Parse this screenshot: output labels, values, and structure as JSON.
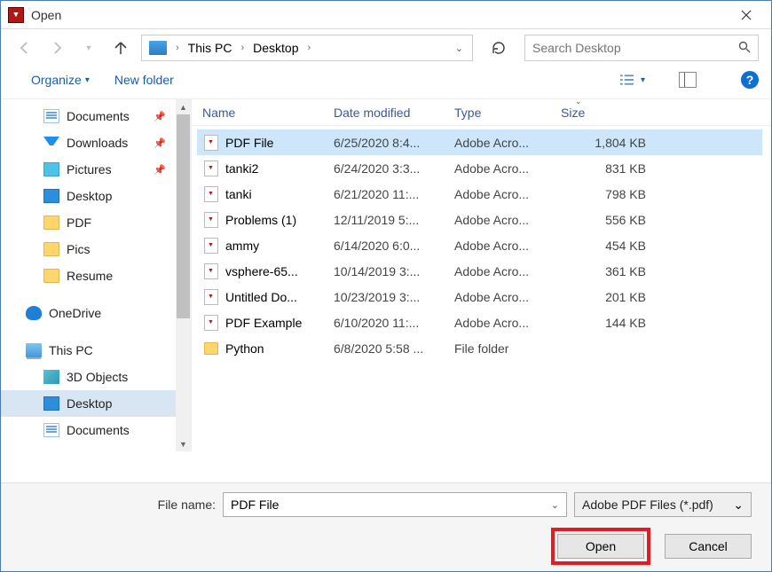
{
  "title": "Open",
  "breadcrumbs": {
    "item0": "This PC",
    "item1": "Desktop"
  },
  "search": {
    "placeholder": "Search Desktop"
  },
  "toolbar": {
    "organize": "Organize",
    "newfolder": "New folder"
  },
  "sidebar": {
    "items": [
      {
        "label": "Documents",
        "icon": "docs",
        "pinned": true,
        "level": 2
      },
      {
        "label": "Downloads",
        "icon": "down",
        "pinned": true,
        "level": 2
      },
      {
        "label": "Pictures",
        "icon": "pics",
        "pinned": true,
        "level": 2
      },
      {
        "label": "Desktop",
        "icon": "desk",
        "pinned": false,
        "level": 2
      },
      {
        "label": "PDF",
        "icon": "folder",
        "pinned": false,
        "level": 2
      },
      {
        "label": "Pics",
        "icon": "folder",
        "pinned": false,
        "level": 2
      },
      {
        "label": "Resume",
        "icon": "folder",
        "pinned": false,
        "level": 2
      },
      {
        "label": "OneDrive",
        "icon": "cloud",
        "pinned": false,
        "level": 1
      },
      {
        "label": "This PC",
        "icon": "pc",
        "pinned": false,
        "level": 1
      },
      {
        "label": "3D Objects",
        "icon": "3d",
        "pinned": false,
        "level": 2
      },
      {
        "label": "Desktop",
        "icon": "desk",
        "pinned": false,
        "level": 2,
        "selected": true
      },
      {
        "label": "Documents",
        "icon": "docs",
        "pinned": false,
        "level": 2,
        "cut": true
      }
    ]
  },
  "columns": {
    "name": "Name",
    "date": "Date modified",
    "type": "Type",
    "size": "Size"
  },
  "files": [
    {
      "name": "PDF File",
      "date": "6/25/2020 8:4...",
      "type": "Adobe Acro...",
      "size": "1,804 KB",
      "icon": "pdf",
      "selected": true
    },
    {
      "name": "tanki2",
      "date": "6/24/2020 3:3...",
      "type": "Adobe Acro...",
      "size": "831 KB",
      "icon": "pdf"
    },
    {
      "name": "tanki",
      "date": "6/21/2020 11:...",
      "type": "Adobe Acro...",
      "size": "798 KB",
      "icon": "pdf"
    },
    {
      "name": "Problems (1)",
      "date": "12/11/2019 5:...",
      "type": "Adobe Acro...",
      "size": "556 KB",
      "icon": "pdf"
    },
    {
      "name": "ammy",
      "date": "6/14/2020 6:0...",
      "type": "Adobe Acro...",
      "size": "454 KB",
      "icon": "pdf"
    },
    {
      "name": "vsphere-65...",
      "date": "10/14/2019 3:...",
      "type": "Adobe Acro...",
      "size": "361 KB",
      "icon": "pdf"
    },
    {
      "name": "Untitled Do...",
      "date": "10/23/2019 3:...",
      "type": "Adobe Acro...",
      "size": "201 KB",
      "icon": "pdf"
    },
    {
      "name": "PDF Example",
      "date": "6/10/2020 11:...",
      "type": "Adobe Acro...",
      "size": "144 KB",
      "icon": "pdf"
    },
    {
      "name": "Python",
      "date": "6/8/2020 5:58 ...",
      "type": "File folder",
      "size": "",
      "icon": "folder"
    }
  ],
  "footer": {
    "filename_label": "File name:",
    "filename_value": "PDF File",
    "filter_value": "Adobe PDF Files (*.pdf)",
    "open": "Open",
    "cancel": "Cancel"
  }
}
